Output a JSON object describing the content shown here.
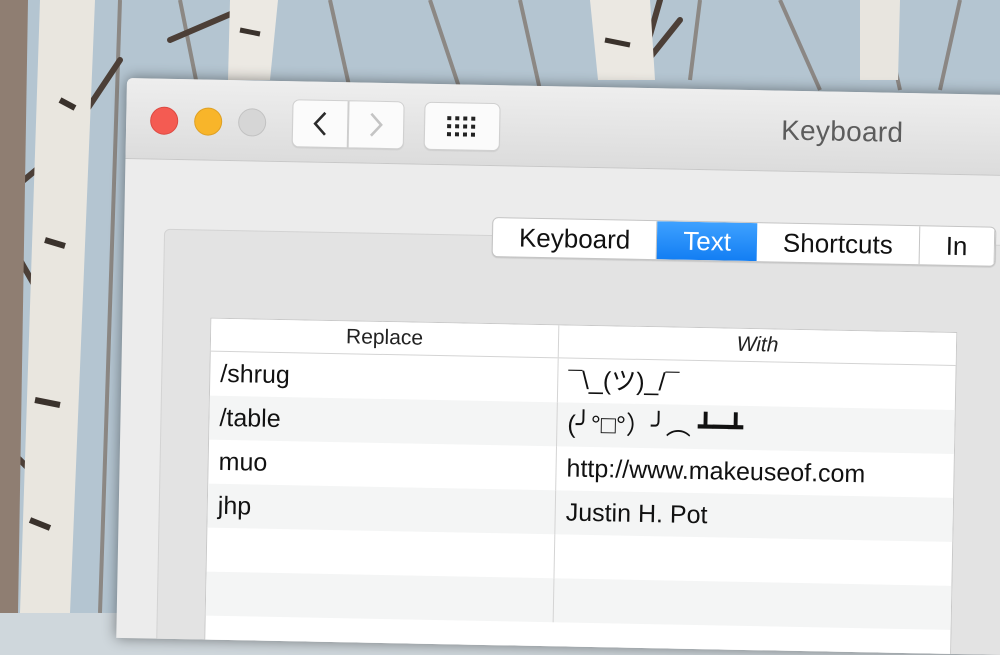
{
  "window": {
    "title": "Keyboard",
    "nav": {
      "back_icon": "chevron-left-icon",
      "forward_icon": "chevron-right-icon",
      "grid_icon": "grid-icon"
    }
  },
  "tabs": [
    {
      "label": "Keyboard",
      "active": false
    },
    {
      "label": "Text",
      "active": true
    },
    {
      "label": "Shortcuts",
      "active": false
    },
    {
      "label": "In",
      "active": false
    }
  ],
  "text_replacement": {
    "columns": [
      "Replace",
      "With"
    ],
    "rows": [
      {
        "replace": "/shrug",
        "with": "¯\\_(ツ)_/¯"
      },
      {
        "replace": "/table",
        "with": "(╯°□°）╯︵ ┻━┻"
      },
      {
        "replace": "muo",
        "with": "http://www.makeuseof.com"
      },
      {
        "replace": "jhp",
        "with": "Justin H. Pot"
      }
    ]
  },
  "colors": {
    "close": "#f45b52",
    "minimize": "#f8b52a",
    "maximize": "#d6d6d6",
    "tab_active": "#137ef3"
  }
}
